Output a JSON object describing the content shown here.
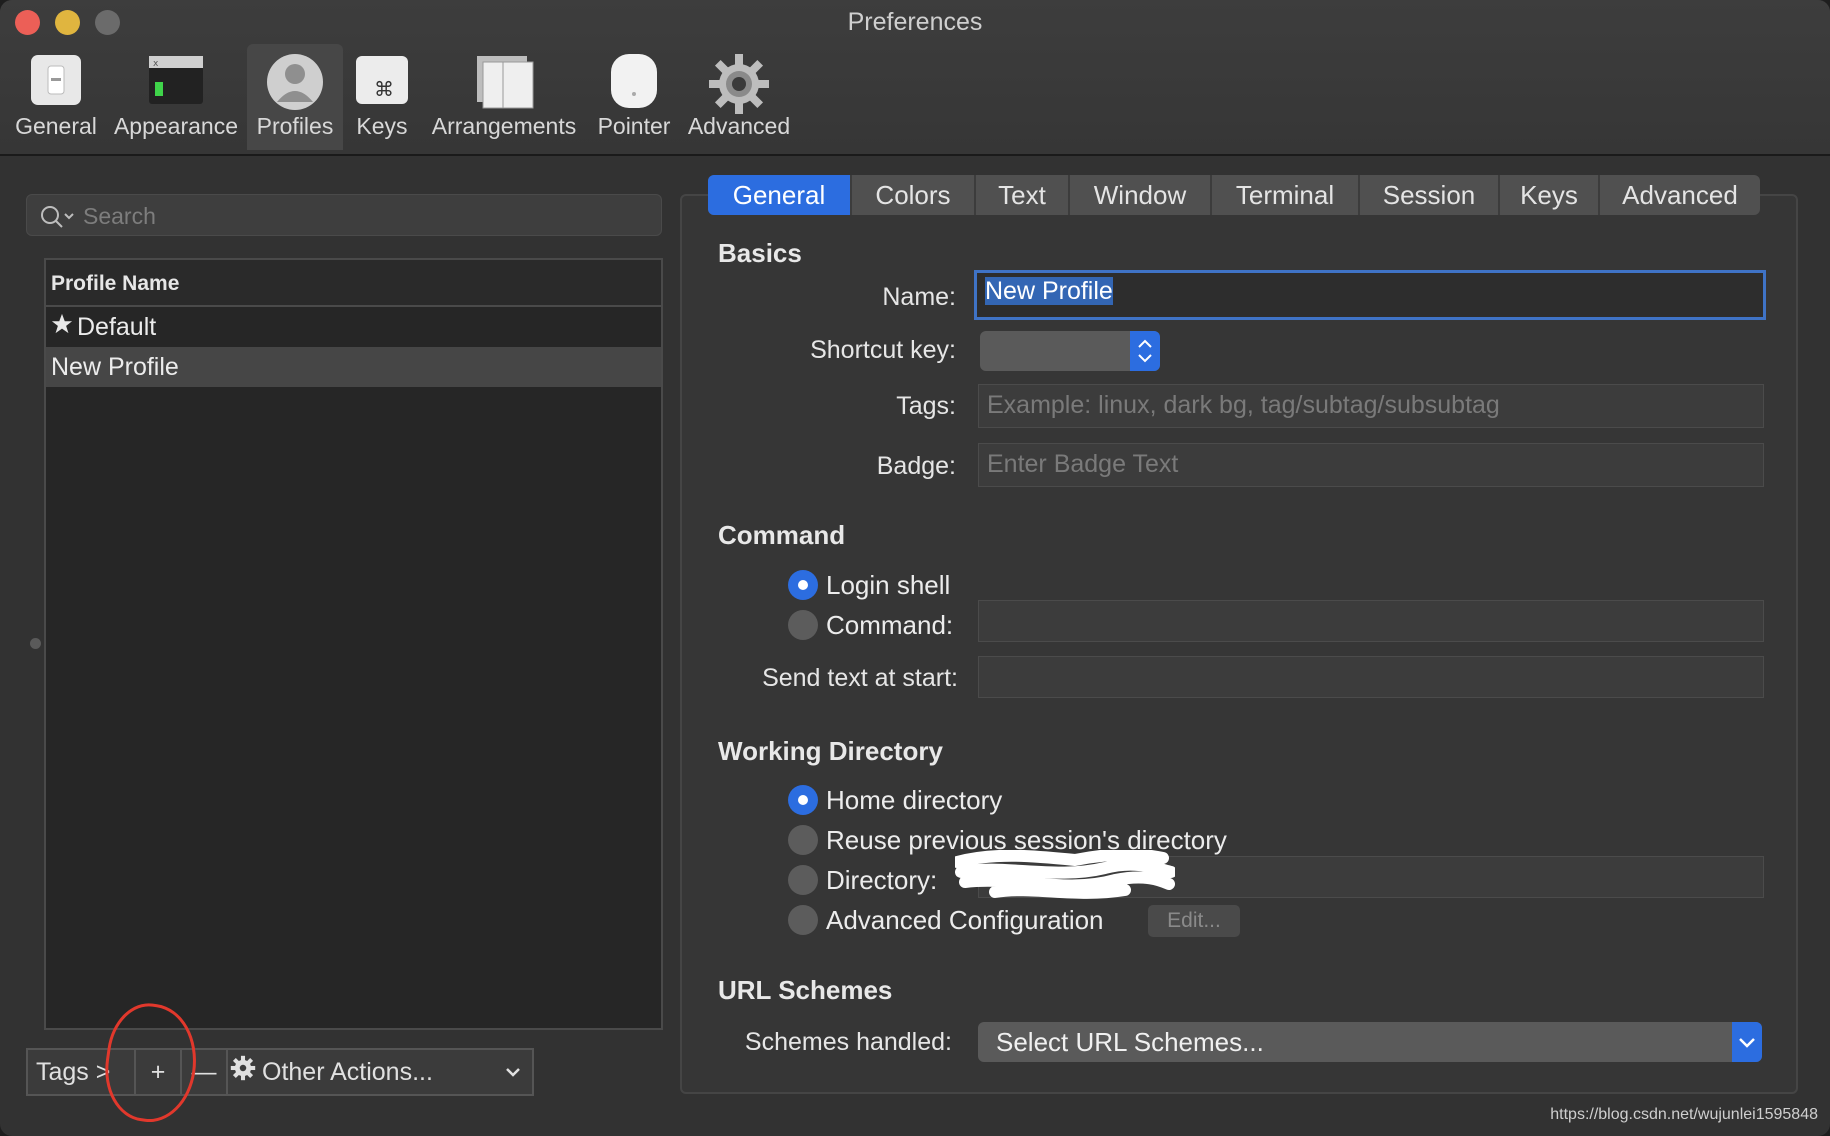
{
  "window": {
    "title": "Preferences"
  },
  "toolbar": {
    "items": [
      {
        "label": "General",
        "icon": "general-switch-icon"
      },
      {
        "label": "Appearance",
        "icon": "appearance-terminal-icon"
      },
      {
        "label": "Profiles",
        "icon": "profile-person-icon",
        "active": true
      },
      {
        "label": "Keys",
        "icon": "command-key-icon"
      },
      {
        "label": "Arrangements",
        "icon": "arrangements-windows-icon"
      },
      {
        "label": "Pointer",
        "icon": "mouse-pointer-icon"
      },
      {
        "label": "Advanced",
        "icon": "gear-icon"
      }
    ]
  },
  "profiles": {
    "search_placeholder": "Search",
    "column_header": "Profile Name",
    "rows": [
      {
        "name": "Default",
        "is_default": true
      },
      {
        "name": "New Profile",
        "selected": true
      }
    ],
    "bottom": {
      "tags_label": "Tags >",
      "add_label": "+",
      "remove_label": "—",
      "other_actions_label": "Other Actions..."
    }
  },
  "tabs": [
    "General",
    "Colors",
    "Text",
    "Window",
    "Terminal",
    "Session",
    "Keys",
    "Advanced"
  ],
  "active_tab": "General",
  "basics": {
    "heading": "Basics",
    "name_label": "Name:",
    "name_value": "New Profile",
    "shortcut_label": "Shortcut key:",
    "tags_label": "Tags:",
    "tags_placeholder": "Example: linux, dark bg, tag/subtag/subsubtag",
    "badge_label": "Badge:",
    "badge_placeholder": "Enter Badge Text"
  },
  "command": {
    "heading": "Command",
    "login_shell": "Login shell",
    "command_label": "Command:",
    "send_text_label": "Send text at start:",
    "selected": "login_shell"
  },
  "working_directory": {
    "heading": "Working Directory",
    "home": "Home directory",
    "reuse": "Reuse previous session's directory",
    "directory": "Directory:",
    "advanced": "Advanced Configuration",
    "edit_button": "Edit...",
    "selected": "home"
  },
  "url_schemes": {
    "heading": "URL Schemes",
    "label": "Schemes handled:",
    "select_value": "Select URL Schemes..."
  },
  "watermark": "https://blog.csdn.net/wujunlei1595848",
  "colors": {
    "accent": "#2c6de0",
    "annotation_red": "#e1382c"
  }
}
